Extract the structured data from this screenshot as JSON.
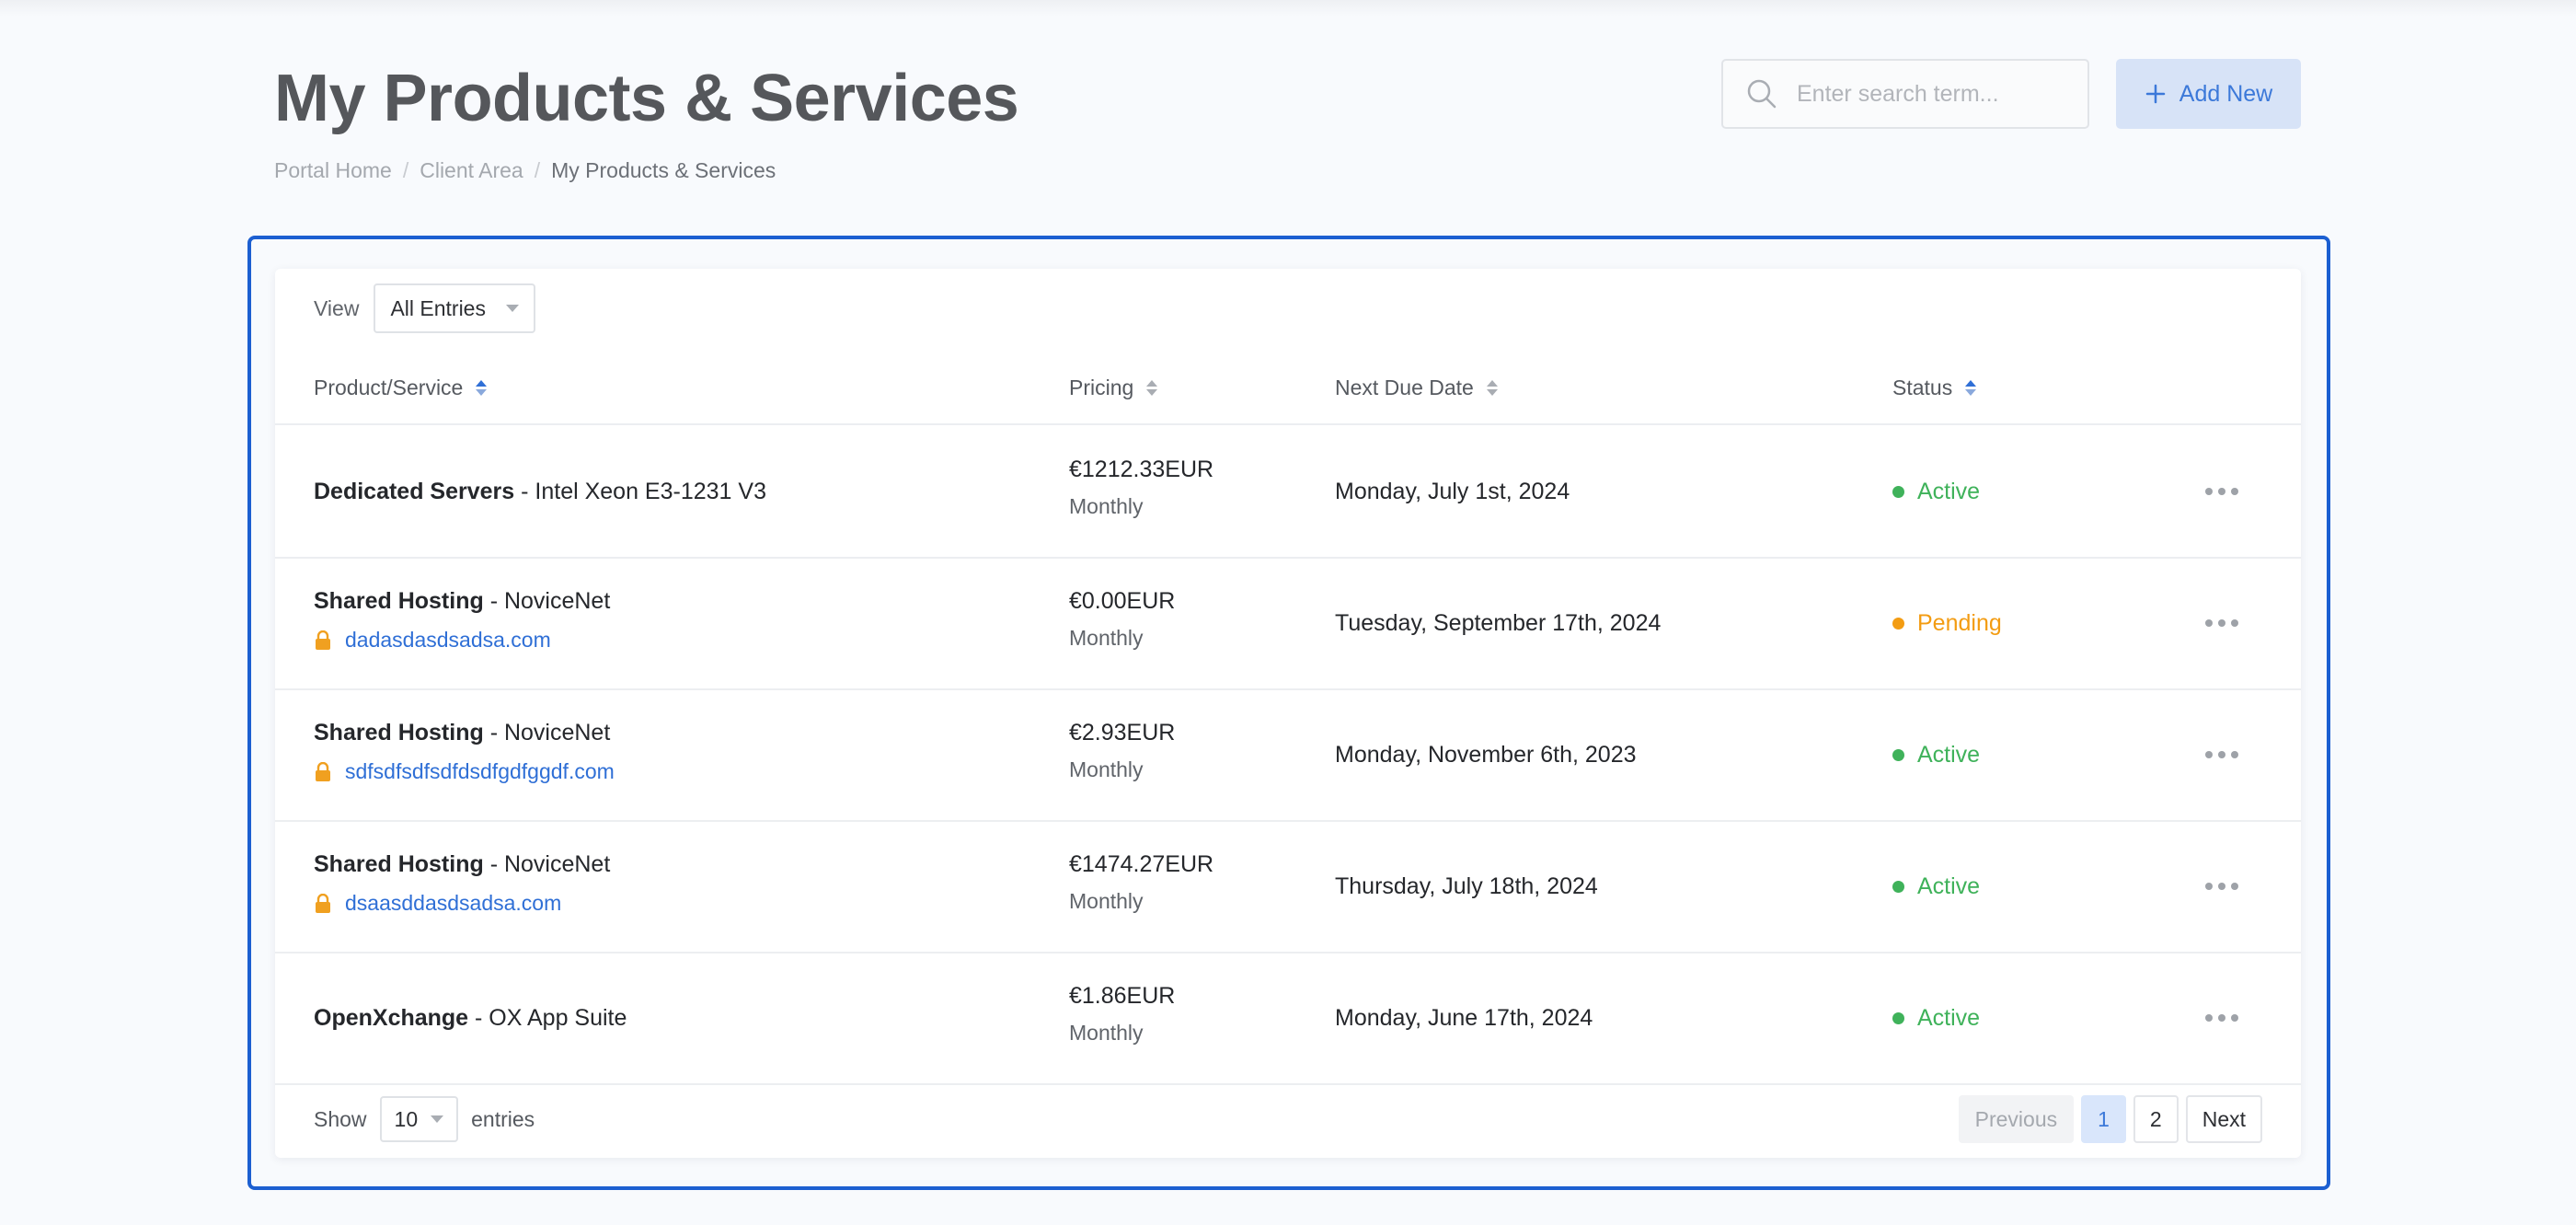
{
  "header": {
    "title": "My Products & Services",
    "breadcrumb": [
      "Portal Home",
      "Client Area",
      "My Products & Services"
    ],
    "search_placeholder": "Enter search term...",
    "add_new_label": "Add New"
  },
  "filters": {
    "view_label": "View",
    "view_value": "All Entries"
  },
  "table": {
    "columns": [
      "Product/Service",
      "Pricing",
      "Next Due Date",
      "Status"
    ],
    "rows": [
      {
        "product": "Dedicated Servers",
        "plan": " - Intel Xeon E3-1231 V3",
        "domain": "",
        "price": "€1212.33EUR",
        "cycle": "Monthly",
        "due": "Monday, July 1st, 2024",
        "status": "Active"
      },
      {
        "product": "Shared Hosting",
        "plan": " - NoviceNet",
        "domain": "dadasdasdsadsa.com",
        "price": "€0.00EUR",
        "cycle": "Monthly",
        "due": "Tuesday, September 17th, 2024",
        "status": "Pending"
      },
      {
        "product": "Shared Hosting",
        "plan": " - NoviceNet",
        "domain": "sdfsdfsdfsdfdsdfgdfggdf.com",
        "price": "€2.93EUR",
        "cycle": "Monthly",
        "due": "Monday, November 6th, 2023",
        "status": "Active"
      },
      {
        "product": "Shared Hosting",
        "plan": " - NoviceNet",
        "domain": "dsaasddasdsadsa.com",
        "price": "€1474.27EUR",
        "cycle": "Monthly",
        "due": "Thursday, July 18th, 2024",
        "status": "Active"
      },
      {
        "product": "OpenXchange",
        "plan": " - OX App Suite",
        "domain": "",
        "price": "€1.86EUR",
        "cycle": "Monthly",
        "due": "Monday, June 17th, 2024",
        "status": "Active"
      }
    ]
  },
  "footer": {
    "show_label": "Show",
    "page_size": "10",
    "entries_label": "entries",
    "previous_label": "Previous",
    "pages": [
      "1",
      "2"
    ],
    "next_label": "Next"
  },
  "colors": {
    "accent": "#2f6fd6",
    "active": "#3fb25a",
    "pending": "#f39c12",
    "lock": "#f0a020",
    "highlight_frame": "#1c5fd1"
  },
  "icons": {
    "search": "search-icon",
    "add": "plus-icon",
    "lock": "lock-icon",
    "more": "more-horizontal-icon"
  }
}
